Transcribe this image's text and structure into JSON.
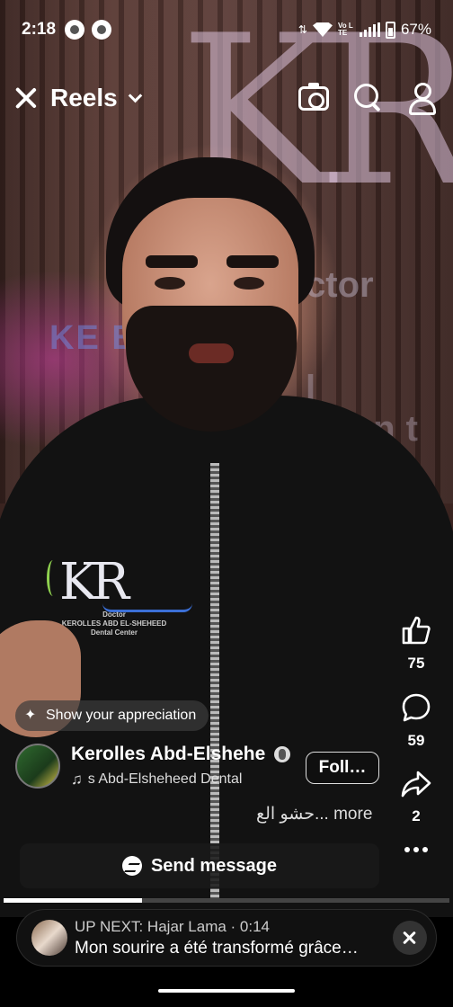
{
  "status_bar": {
    "time": "2:18",
    "battery": "67%",
    "network_label": "Vo LTE",
    "battery_level": 0.67
  },
  "header": {
    "title": "Reels"
  },
  "video_scene": {
    "wall_doctor": "ctor",
    "wall_name": "KE  BDEL.S",
    "wall_center": "l Cent",
    "jacket_logo": "KR",
    "jacket_sub": "Doctor\nKEROLLES ABD EL-SHEHEED\nDental Center"
  },
  "actions": {
    "likes": "75",
    "comments": "59",
    "shares": "2"
  },
  "appreciation": {
    "label": "Show your appreciation"
  },
  "author": {
    "name": "Kerolles Abd-Elshehe…",
    "audio": "s Abd-Elsheheed Dental",
    "follow_label": "Foll…"
  },
  "caption": {
    "text": "حشو الع... more"
  },
  "send_message": {
    "label": "Send message"
  },
  "progress": {
    "fraction": 0.31
  },
  "up_next": {
    "line1": "UP NEXT: Hajar Lama · 0:14",
    "line2": "Mon sourire a été transformé grâce…"
  }
}
